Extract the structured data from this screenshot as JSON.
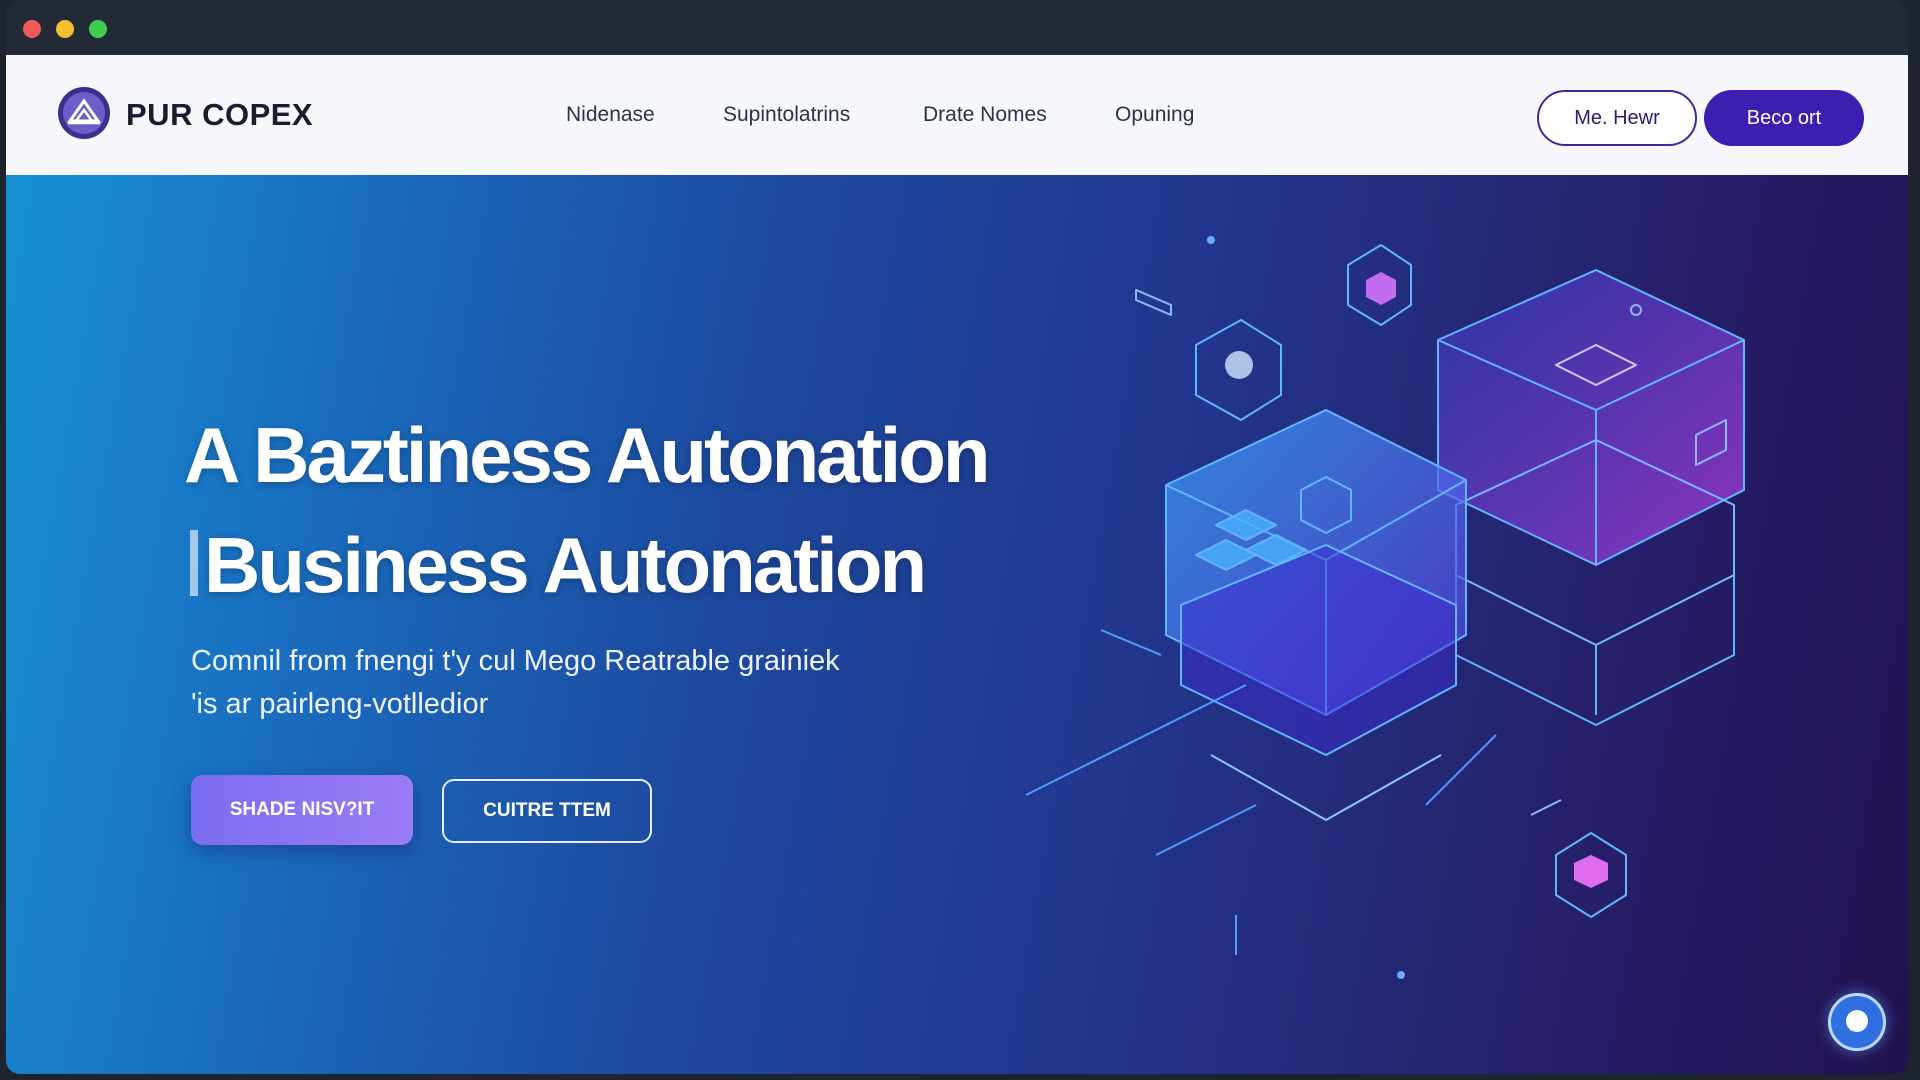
{
  "window": {
    "controls": [
      "close",
      "minimize",
      "maximize"
    ]
  },
  "nav": {
    "logo_text": "PUR COPEX",
    "links": [
      "Nidenase",
      "Supintolatrins",
      "Drate Nomes",
      "Opuning"
    ],
    "outline_button": "Me. Hewr",
    "solid_button": "Beco ort"
  },
  "hero": {
    "title_line1": "A Baztiness Autonation",
    "title_line2": "Business Autonation",
    "subtitle_line1": "Comnil from fnengi t'y cul Mego Reatrable grainiek",
    "subtitle_line2": "'is ar pairleng-votlledior",
    "primary_button": "SHADE NISV?IT",
    "secondary_button": "CUITRE TTEM"
  },
  "colors": {
    "accent": "#3b1fb0",
    "hero_gradient_start": "#1690d3",
    "hero_gradient_end": "#22124f",
    "primary_button": "#8a75f4"
  },
  "icons": [
    "logo-icon",
    "chat-icon",
    "isometric-server-illustration"
  ]
}
